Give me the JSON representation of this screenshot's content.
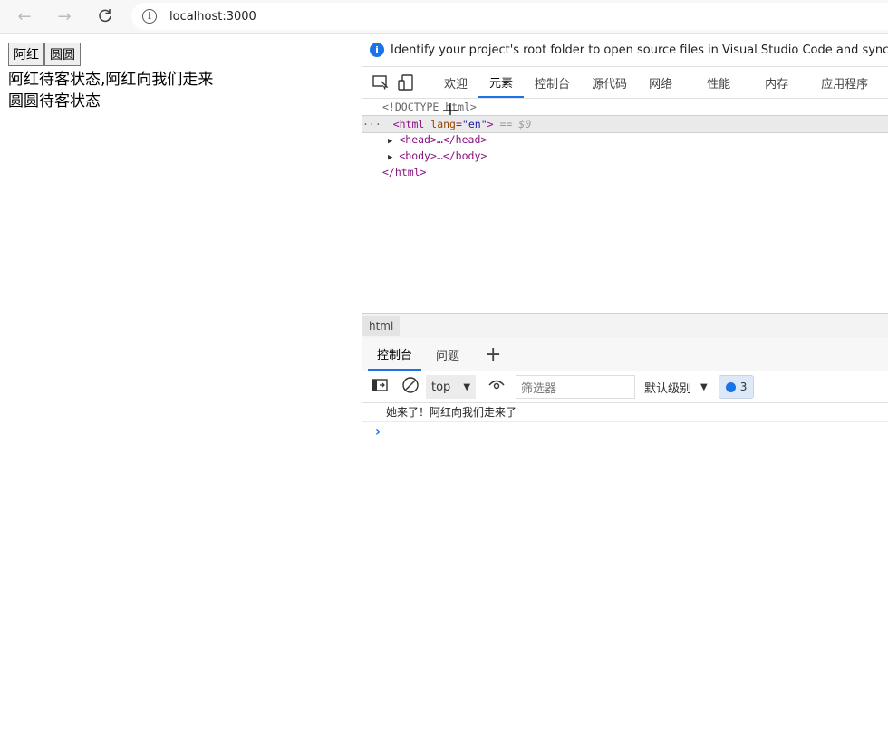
{
  "browser": {
    "url": "localhost:3000"
  },
  "page": {
    "buttons": [
      "阿红",
      "圆圆"
    ],
    "lines": [
      "阿红待客状态,阿红向我们走来",
      "圆圆待客状态"
    ]
  },
  "devtools": {
    "infobar": "Identify your project's root folder to open source files in Visual Studio Code and sync changes.",
    "tabs": [
      "欢迎",
      "元素",
      "控制台",
      "源代码",
      "网络",
      "性能",
      "内存",
      "应用程序"
    ],
    "dom": {
      "doctype": "<!DOCTYPE html>",
      "html_open": "<html",
      "lang_attr": "lang",
      "lang_val": "\"en\"",
      "eq_sel": "== $0",
      "head": "<head>…</head>",
      "body": "<body>…</body>",
      "html_close": "</html>"
    },
    "breadcrumb": "html",
    "drawer_tabs": [
      "控制台",
      "问题"
    ],
    "console": {
      "context": "top",
      "filter_placeholder": "筛选器",
      "level": "默认级别",
      "message_count": "3",
      "log": "她来了！阿红向我们走来了"
    }
  }
}
